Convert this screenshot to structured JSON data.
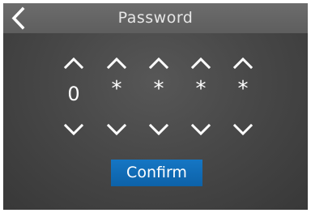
{
  "header": {
    "title": "Password",
    "back_icon": "chevron-left-icon"
  },
  "digits": [
    {
      "value": "0"
    },
    {
      "value": "*"
    },
    {
      "value": "*"
    },
    {
      "value": "*"
    },
    {
      "value": "*"
    }
  ],
  "icons": {
    "up": "chevron-up-icon",
    "down": "chevron-down-icon"
  },
  "confirm": {
    "label": "Confirm"
  },
  "colors": {
    "accent": "#0e67b0",
    "text": "#ffffff",
    "header_text": "#e6e6e6"
  }
}
